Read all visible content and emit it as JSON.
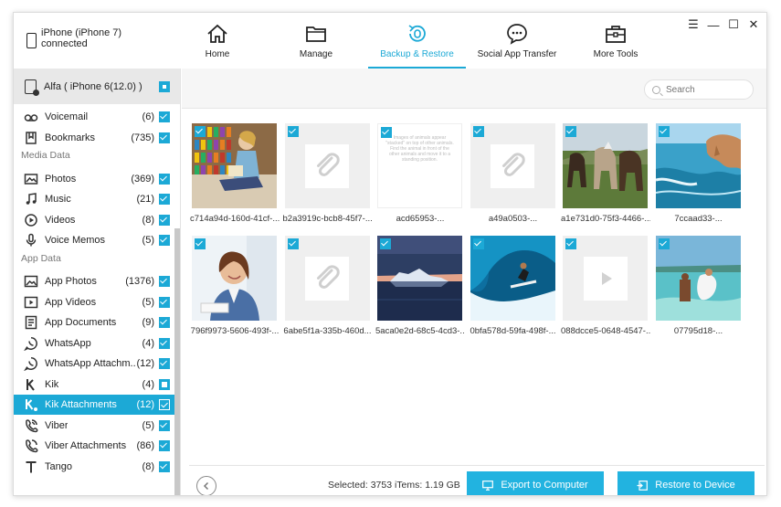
{
  "device": {
    "line1": "iPhone (iPhone 7)",
    "line2": "connected"
  },
  "nav": [
    {
      "label": "Home",
      "icon": "home-icon"
    },
    {
      "label": "Manage",
      "icon": "folder-icon"
    },
    {
      "label": "Backup & Restore",
      "icon": "backup-icon",
      "active": true
    },
    {
      "label": "Social App Transfer",
      "icon": "chat-icon"
    },
    {
      "label": "More Tools",
      "icon": "toolbox-icon"
    }
  ],
  "window_controls": {
    "menu": "☰",
    "minimize": "—",
    "maximize": "☐",
    "close": "✕"
  },
  "sidebar": {
    "backup_name": "Alfa ( iPhone 6(12.0) )",
    "items": [
      {
        "label": "Voicemail",
        "count": "(6)",
        "icon": "voicemail-icon"
      },
      {
        "label": "Bookmarks",
        "count": "(735)",
        "icon": "bookmark-icon"
      },
      {
        "section": "Media Data"
      },
      {
        "label": "Photos",
        "count": "(369)",
        "icon": "photo-icon"
      },
      {
        "label": "Music",
        "count": "(21)",
        "icon": "music-icon"
      },
      {
        "label": "Videos",
        "count": "(8)",
        "icon": "video-icon"
      },
      {
        "label": "Voice Memos",
        "count": "(5)",
        "icon": "microphone-icon"
      },
      {
        "section": "App Data"
      },
      {
        "label": "App Photos",
        "count": "(1376)",
        "icon": "app-photo-icon"
      },
      {
        "label": "App Videos",
        "count": "(5)",
        "icon": "app-video-icon"
      },
      {
        "label": "App Documents",
        "count": "(9)",
        "icon": "document-icon"
      },
      {
        "label": "WhatsApp",
        "count": "(4)",
        "icon": "whatsapp-icon"
      },
      {
        "label": "WhatsApp Attachm...",
        "count": "(12)",
        "icon": "whatsapp-attachment-icon"
      },
      {
        "label": "Kik",
        "count": "(4)",
        "icon": "kik-icon",
        "partial": true
      },
      {
        "label": "Kik Attachments",
        "count": "(12)",
        "icon": "kik-attachment-icon",
        "selected": true
      },
      {
        "label": "Viber",
        "count": "(5)",
        "icon": "viber-icon"
      },
      {
        "label": "Viber Attachments",
        "count": "(86)",
        "icon": "viber-attachment-icon"
      },
      {
        "label": "Tango",
        "count": "(8)",
        "icon": "tango-icon"
      }
    ]
  },
  "search": {
    "placeholder": "Search"
  },
  "thumbnails": [
    {
      "caption": "c714a94d-160d-41cf-...",
      "kind": "photo-reading"
    },
    {
      "caption": "b2a3919c-bcb8-45f7-...",
      "kind": "attachment"
    },
    {
      "caption": "acd65953-...",
      "kind": "text-image",
      "text": "Images of animals appear \"stacked\" on top of other animals. Find the animal in front of the other animals and move it to a standing position."
    },
    {
      "caption": "a49a0503-...",
      "kind": "attachment"
    },
    {
      "caption": "a1e731d0-75f3-4466-...",
      "kind": "photo-horses"
    },
    {
      "caption": "7ccaad33-...",
      "kind": "photo-coast"
    },
    {
      "caption": "796f9973-5606-493f-...",
      "kind": "photo-woman"
    },
    {
      "caption": "6abe5f1a-335b-460d...",
      "kind": "attachment"
    },
    {
      "caption": "5aca0e2d-68c5-4cd3-...",
      "kind": "photo-iceberg"
    },
    {
      "caption": "0bfa578d-59fa-498f-...",
      "kind": "photo-surf"
    },
    {
      "caption": "088dcce5-0648-4547-...",
      "kind": "video"
    },
    {
      "caption": "07795d18-...",
      "kind": "photo-beach"
    }
  ],
  "footer": {
    "selected": "Selected: 3753 iTems: 1.19 GB",
    "export_label": "Export to Computer",
    "restore_label": "Restore to Device"
  },
  "colors": {
    "accent": "#1ca9d6",
    "button": "#22b3e0"
  }
}
